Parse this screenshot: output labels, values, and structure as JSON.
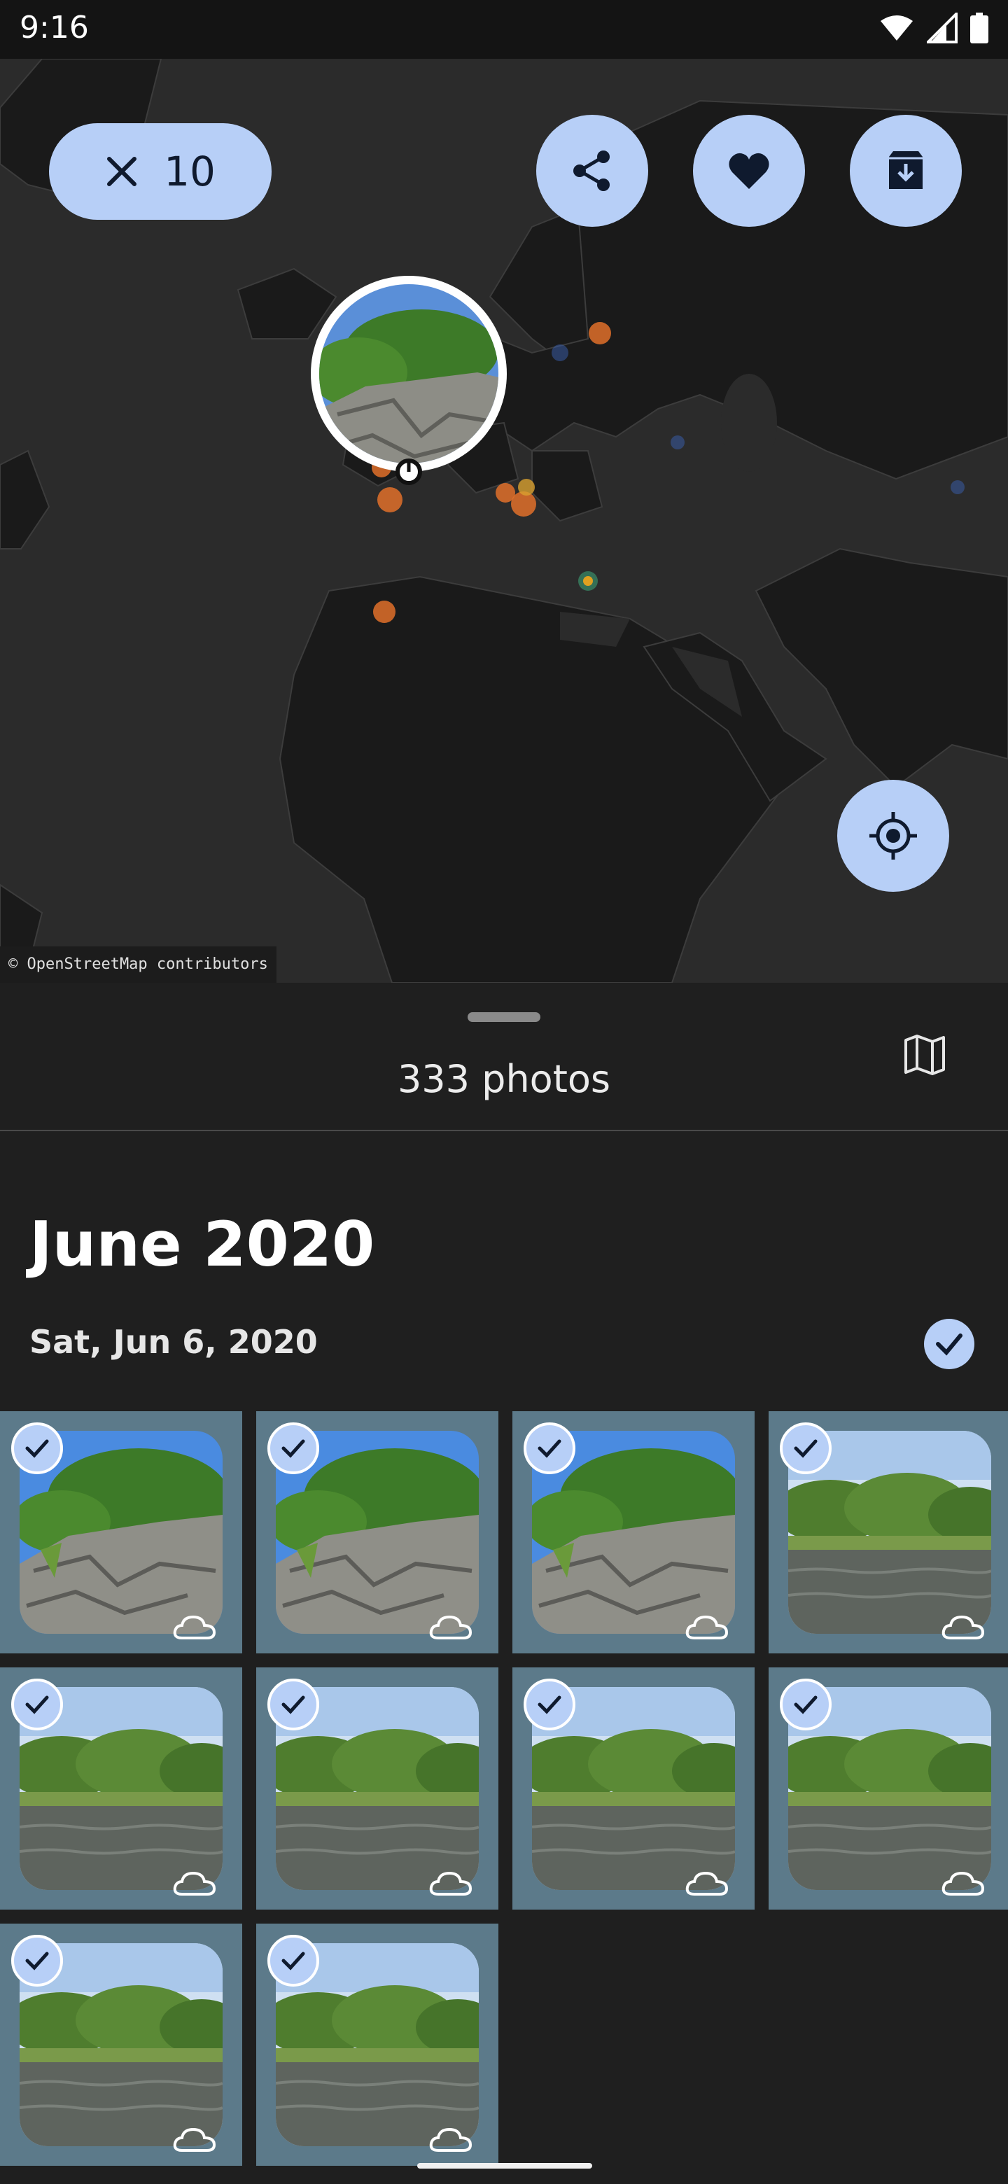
{
  "status_bar": {
    "time": "9:16",
    "icons": [
      "wifi-icon",
      "signal-icon",
      "battery-icon"
    ]
  },
  "selection": {
    "count": "10",
    "icon": "close-icon"
  },
  "actions": {
    "share_icon": "share-icon",
    "favorite_icon": "heart-icon",
    "archive_icon": "archive-icon"
  },
  "map": {
    "attribution": "© OpenStreetMap contributors",
    "locate_icon": "my-location-icon"
  },
  "sheet": {
    "photo_count": "333 photos",
    "map_toggle_icon": "map-icon"
  },
  "timeline": {
    "month": "June 2020",
    "day": "Sat, Jun 6, 2020"
  },
  "photos": [
    {
      "scene": "rock"
    },
    {
      "scene": "rock"
    },
    {
      "scene": "rock"
    },
    {
      "scene": "lake"
    },
    {
      "scene": "lake"
    },
    {
      "scene": "lake"
    },
    {
      "scene": "lake"
    },
    {
      "scene": "lake"
    },
    {
      "scene": "lake"
    },
    {
      "scene": "lake"
    }
  ],
  "colors": {
    "accent": "#b7cff7",
    "cell_bg": "#5c7a8a",
    "background": "#1f1f1f"
  }
}
